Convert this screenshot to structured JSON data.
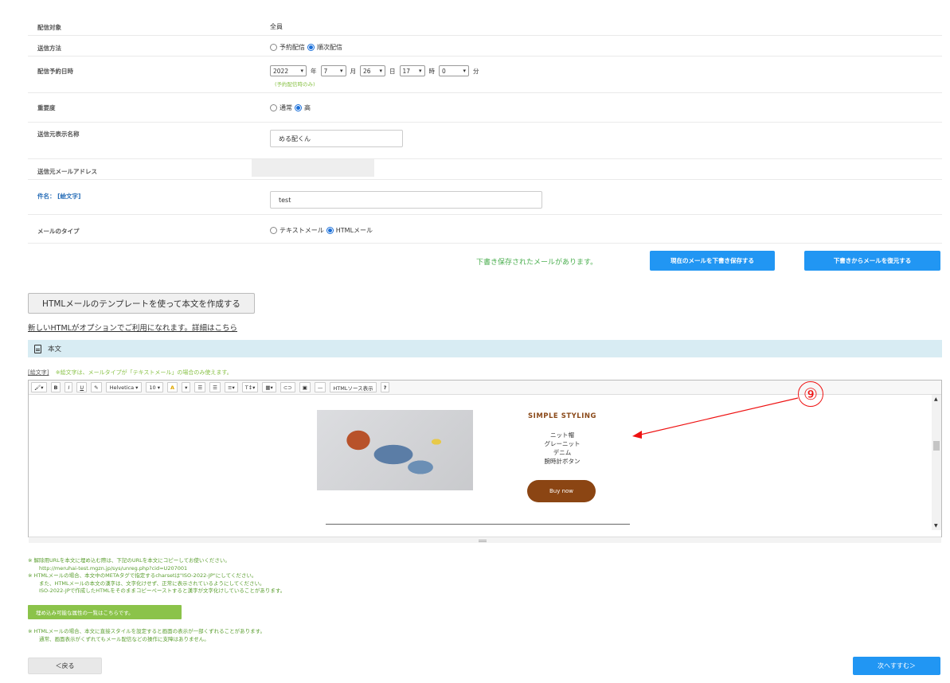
{
  "form": {
    "rows": [
      {
        "label": "配信対象",
        "value": "全員"
      },
      {
        "label": "送信方法",
        "opt1": "予約配信",
        "opt2": "順次配信"
      },
      {
        "label": "配信予約日時",
        "year": "2022",
        "year_unit": "年",
        "month": "7",
        "month_unit": "月",
        "day": "26",
        "day_unit": "日",
        "hour": "17",
        "hour_unit": "時",
        "minute": "0",
        "minute_unit": "分",
        "note": "(予約配信時のみ)"
      },
      {
        "label": "重要度",
        "opt1": "通常",
        "opt2": "高"
      },
      {
        "label": "送信元表示名称",
        "value": "める配くん"
      },
      {
        "label": "送信元メールアドレス"
      },
      {
        "label": "件名： [絵文字]",
        "value": "test"
      },
      {
        "label": "メールのタイプ",
        "opt1": "テキストメール",
        "opt2": "HTMLメール"
      }
    ]
  },
  "draft": {
    "note": "下書き保存されたメールがあります。",
    "save_label": "現在のメールを下書き保存する",
    "restore_label": "下書きからメールを復元する"
  },
  "template_button": "HTMLメールのテンプレートを使って本文を作成する",
  "new_html_link": "新しいHTMLがオプションでご利用になれます。詳細はこちら",
  "body_section": "本文",
  "emoji_note": {
    "tag": "[絵文字]",
    "text": "※絵文字は、メールタイプが「テキストメール」の場合のみ使えます。"
  },
  "toolbar": {
    "font": "Helvetica",
    "size": "10",
    "source": "HTMLソース表示",
    "help": "?"
  },
  "preview": {
    "title": "SIMPLE STYLING",
    "lines": [
      "ニット帽",
      "グレーニット",
      "デニム",
      "腕時計ボタン"
    ],
    "button": "Buy now"
  },
  "callout": "⑨",
  "notes": {
    "n1": "※ 解除用URLを本文に埋め込む際は、下記のURLを本文にコピーしてお使いください。",
    "n1_url": "http://meruhai-test.mgzn.jp/sys/unreg.php?cid=U207001",
    "n2": "※ HTMLメールの場合、本文中のMETAタグで指定するcharsetは\"ISO-2022-JP\"にしてください。",
    "n3": "また、HTMLメールの本文の漢字は、文字化けせず、正常に表示されているようにしてください。",
    "n4": "ISO-2022-JPで作成したHTMLをそのままコピーペーストすると漢字が文字化けしていることがあります。",
    "green_button": "埋め込み可能な属性の一覧はこちらです。",
    "n5": "※ HTMLメールの場合、本文に直接スタイルを設定すると画面の表示が一部くずれることがあります。",
    "n6": "通常、画面表示がくずれてもメール配信などの操作に支障はありません。"
  },
  "nav": {
    "back": "＜戻る",
    "next": "次へすすむ＞"
  },
  "colors": {
    "accent": "#2196f3",
    "green": "#8bc34a",
    "brown": "#8b4513",
    "callout": "#e11111"
  }
}
